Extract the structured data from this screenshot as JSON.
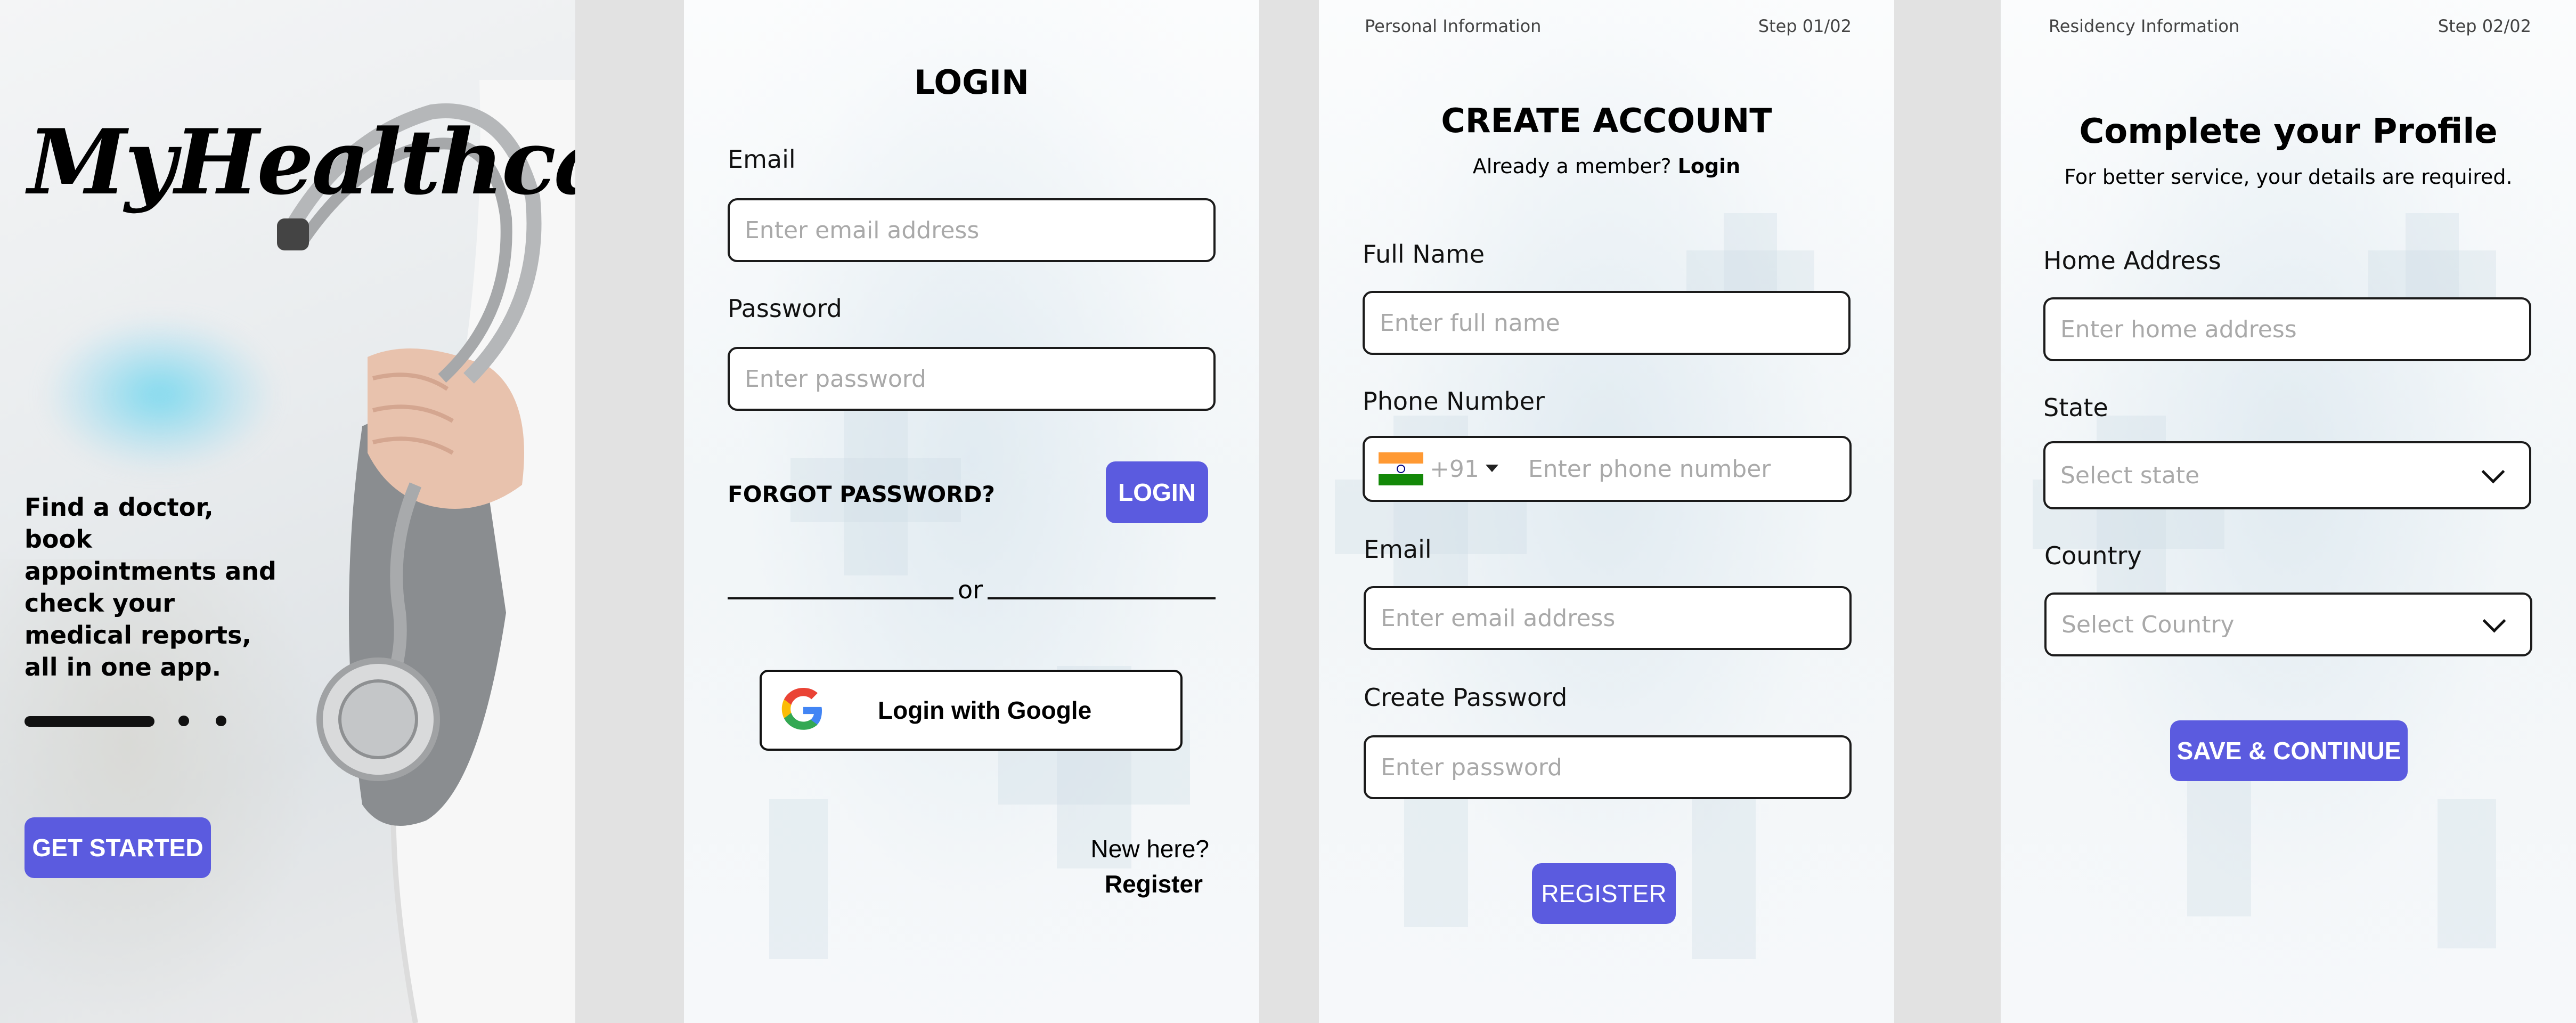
{
  "splash": {
    "app_name": "MyHealthcare",
    "tagline": "Find a doctor, book appointments and check your medical reports, all in one app.",
    "cta": "GET STARTED"
  },
  "login": {
    "title": "LOGIN",
    "email_label": "Email",
    "email_placeholder": "Enter email address",
    "password_label": "Password",
    "password_placeholder": "Enter password",
    "forgot": "FORGOT PASSWORD?",
    "login_button": "LOGIN",
    "divider": "or",
    "google_button": "Login with Google",
    "new_here": "New here?",
    "register_link": "Register"
  },
  "create": {
    "section": "Personal Information",
    "step": "Step 01/02",
    "title": "CREATE ACCOUNT",
    "member_prefix": "Already a member?",
    "member_link": "Login",
    "fullname_label": "Full Name",
    "fullname_placeholder": "Enter full name",
    "phone_label": "Phone Number",
    "country_code": "+91",
    "phone_placeholder": "Enter phone number",
    "email_label": "Email",
    "email_placeholder": "Enter email address",
    "password_label": "Create Password",
    "password_placeholder": "Enter password",
    "register_button": "REGISTER"
  },
  "profile": {
    "section": "Residency Information",
    "step": "Step 02/02",
    "title": "Complete your Profile",
    "subtitle": "For better service, your details are required.",
    "address_label": "Home Address",
    "address_placeholder": "Enter home address",
    "state_label": "State",
    "state_placeholder": "Select state",
    "country_label": "Country",
    "country_placeholder": "Select Country",
    "save_button": "SAVE & CONTINUE"
  },
  "colors": {
    "accent": "#5b5bdf",
    "gap_background": "#e2e2e2",
    "flag_saffron": "#ff9933",
    "flag_green": "#138808"
  },
  "icons": [
    "google-icon",
    "india-flag-icon",
    "caret-down-icon",
    "chevron-down-icon",
    "stethoscope-image"
  ]
}
